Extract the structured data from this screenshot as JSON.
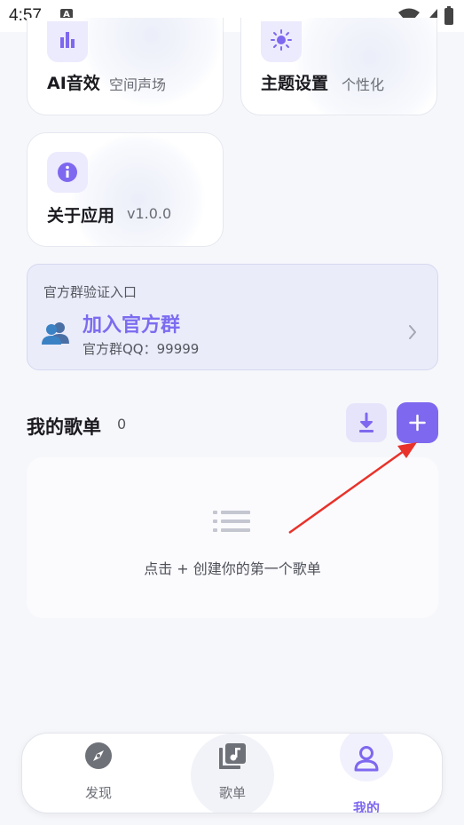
{
  "status": {
    "time": "4:57"
  },
  "features": [
    {
      "title": "AI音效",
      "subtitle": "空间声场",
      "icon": "bar-chart-icon"
    },
    {
      "title": "主题设置",
      "subtitle": "个性化",
      "icon": "sun-icon"
    },
    {
      "title": "关于应用",
      "subtitle": "v1.0.0",
      "icon": "info-icon"
    }
  ],
  "group": {
    "header": "官方群验证入口",
    "title": "加入官方群",
    "qq_line": "官方群QQ：99999"
  },
  "playlists": {
    "title": "我的歌单",
    "count": "0",
    "empty_text": "点击 + 创建你的第一个歌单"
  },
  "nav": [
    {
      "label": "发现",
      "icon": "compass-icon"
    },
    {
      "label": "歌单",
      "icon": "music-library-icon"
    },
    {
      "label": "我的",
      "icon": "user-icon",
      "active": true
    }
  ],
  "colors": {
    "accent": "#7e68ef",
    "background": "#f6f7fb",
    "banner": "#ebecfa"
  }
}
